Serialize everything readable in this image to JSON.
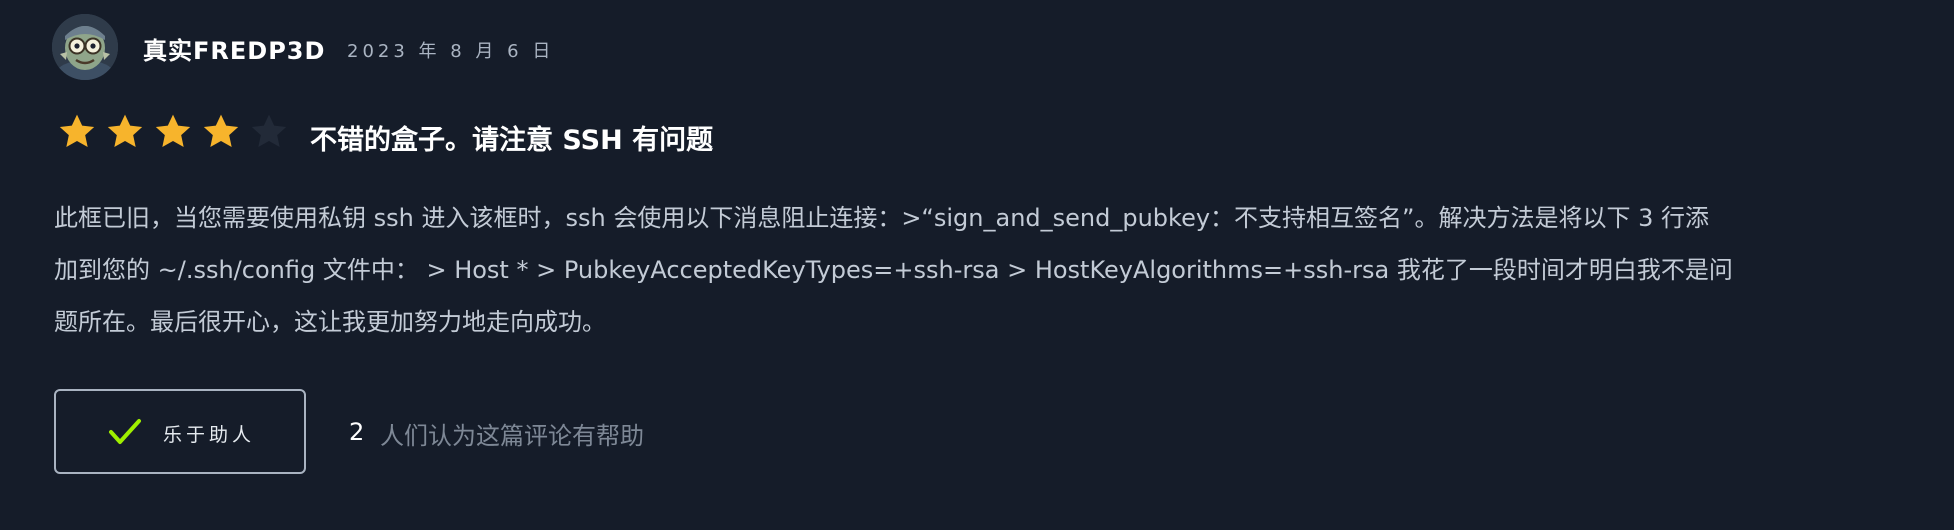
{
  "review": {
    "author": "真实FREDP3D",
    "date": "2023 年 8 月 6 日",
    "rating": 4,
    "max_rating": 5,
    "title": "不错的盒子。请注意 SSH 有问题",
    "body_lines": [
      "此框已旧，当您需要使用私钥 ssh 进入该框时，ssh 会使用以下消息阻止连接：>“sign_and_send_pubkey：不支持相互签名”。解决方法是将以下 3 行添",
      "加到您的 ~/.ssh/config 文件中： > Host * > PubkeyAcceptedKeyTypes=+ssh-rsa > HostKeyAlgorithms=+ssh-rsa 我花了一段时间才明白我不是问",
      "题所在。最后很开心，这让我更加努力地走向成功。"
    ],
    "helpful_button_label": "乐于助人",
    "helpful_count": "2",
    "helpful_text": "人们认为这篇评论有帮助"
  },
  "colors": {
    "background": "#151c29",
    "star_filled": "#f7b42c",
    "star_empty": "#222a38",
    "check": "#9fef00",
    "body_text": "#c3cbd6",
    "muted_text": "#7e8896"
  },
  "icons": {
    "avatar": "avatar-image",
    "star": "star-icon",
    "check": "checkmark-icon"
  }
}
